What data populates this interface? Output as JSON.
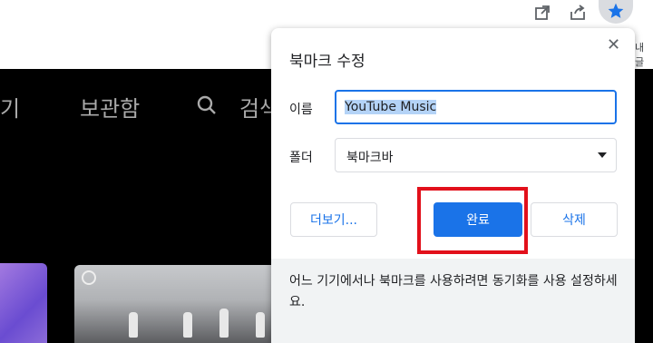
{
  "toolbar": {
    "icons": [
      "open-in-new-icon",
      "share-icon",
      "star-icon"
    ],
    "accent": "#1a73e8",
    "edge_text": "내글"
  },
  "youtube": {
    "nav_partial_left": "기",
    "nav_library": "보관함",
    "nav_search": "검색"
  },
  "dialog": {
    "title": "북마크 수정",
    "name_label": "이름",
    "name_value": "YouTube Music",
    "folder_label": "폴더",
    "folder_value": "북마크바",
    "more_button": "더보기...",
    "done_button": "완료",
    "delete_button": "삭제",
    "sync_message": "어느 기기에서나 북마크를 사용하려면 동기화를 사용 설정하세요.",
    "highlight_color": "#e2101b"
  }
}
